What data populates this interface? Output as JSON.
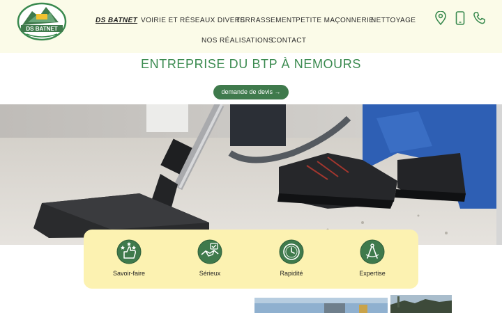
{
  "header": {
    "logo_text": "DS BATNET",
    "nav": [
      {
        "label": "DS BATNET",
        "active": true
      },
      {
        "label": "VOIRIE ET RÉSEAUX DIVERS"
      },
      {
        "label": "TERRASSEMENT"
      },
      {
        "label": "PETITE MAÇONNERIE"
      },
      {
        "label": "NETTOYAGE"
      },
      {
        "label": "NOS RÉALISATIONS"
      },
      {
        "label": "CONTACT"
      }
    ],
    "icons": [
      "location-pin-icon",
      "mobile-phone-icon",
      "phone-icon"
    ]
  },
  "main": {
    "title": "ENTREPRISE DU BTP À NEMOURS",
    "cta_label": "demande de devis →"
  },
  "features": [
    {
      "label": "Savoir-faire",
      "icon": "thumbs-up-stars-icon"
    },
    {
      "label": "Sérieux",
      "icon": "handshake-check-icon"
    },
    {
      "label": "Rapidité",
      "icon": "clock-icon"
    },
    {
      "label": "Expertise",
      "icon": "compass-icon"
    }
  ],
  "colors": {
    "header_bg": "#fbfbe8",
    "accent_green": "#3a8a4f",
    "button_green": "#3f7a4c",
    "features_bg": "#fcf2b1"
  }
}
